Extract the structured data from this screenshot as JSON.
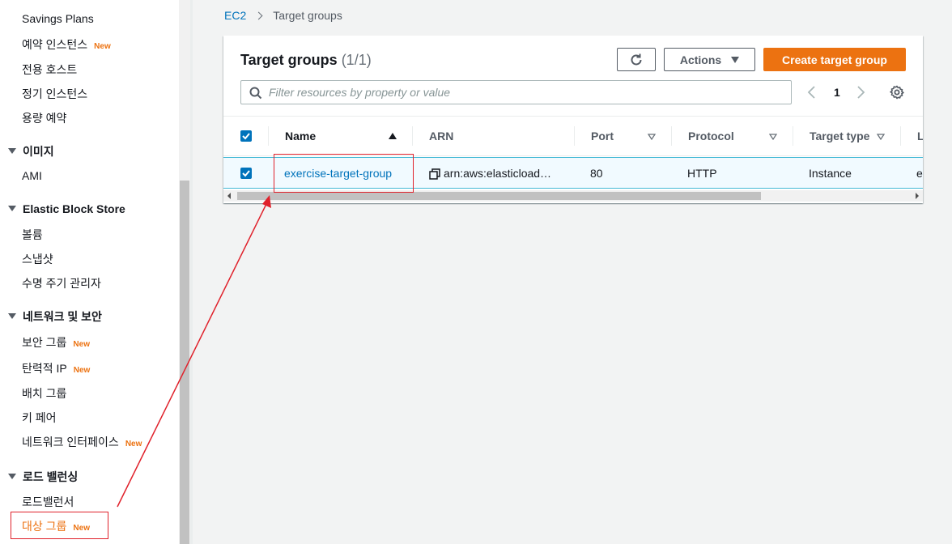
{
  "sidebar": {
    "items_top": [
      {
        "label": "Savings Plans",
        "badge": ""
      },
      {
        "label": "예약 인스턴스",
        "badge": "New"
      },
      {
        "label": "전용 호스트",
        "badge": ""
      },
      {
        "label": "정기 인스턴스",
        "badge": ""
      },
      {
        "label": "용량 예약",
        "badge": ""
      }
    ],
    "sections": [
      {
        "title": "이미지",
        "items": [
          {
            "label": "AMI",
            "badge": ""
          }
        ]
      },
      {
        "title": "Elastic Block Store",
        "items": [
          {
            "label": "볼륨",
            "badge": ""
          },
          {
            "label": "스냅샷",
            "badge": ""
          },
          {
            "label": "수명 주기 관리자",
            "badge": ""
          }
        ]
      },
      {
        "title": "네트워크 및 보안",
        "items": [
          {
            "label": "보안 그룹",
            "badge": "New"
          },
          {
            "label": "탄력적 IP",
            "badge": "New"
          },
          {
            "label": "배치 그룹",
            "badge": ""
          },
          {
            "label": "키 페어",
            "badge": ""
          },
          {
            "label": "네트워크 인터페이스",
            "badge": "New"
          }
        ]
      },
      {
        "title": "로드 밸런싱",
        "items": [
          {
            "label": "로드밸런서",
            "badge": ""
          },
          {
            "label": "대상 그룹",
            "badge": "New"
          }
        ]
      }
    ]
  },
  "breadcrumb": {
    "root": "EC2",
    "current": "Target groups"
  },
  "panel": {
    "title": "Target groups",
    "count": "(1/1)",
    "actions_label": "Actions",
    "create_label": "Create target group",
    "filter_placeholder": "Filter resources by property or value",
    "page_number": "1"
  },
  "table": {
    "columns": [
      "Name",
      "ARN",
      "Port",
      "Protocol",
      "Target type",
      "L"
    ],
    "rows": [
      {
        "selected": true,
        "name": "exercise-target-group",
        "arn": "arn:aws:elasticload…",
        "port": "80",
        "protocol": "HTTP",
        "target_type": "Instance",
        "extra": "e"
      }
    ]
  },
  "colors": {
    "accent": "#ec7211",
    "link": "#0073bb",
    "annotation": "#e0212b"
  }
}
